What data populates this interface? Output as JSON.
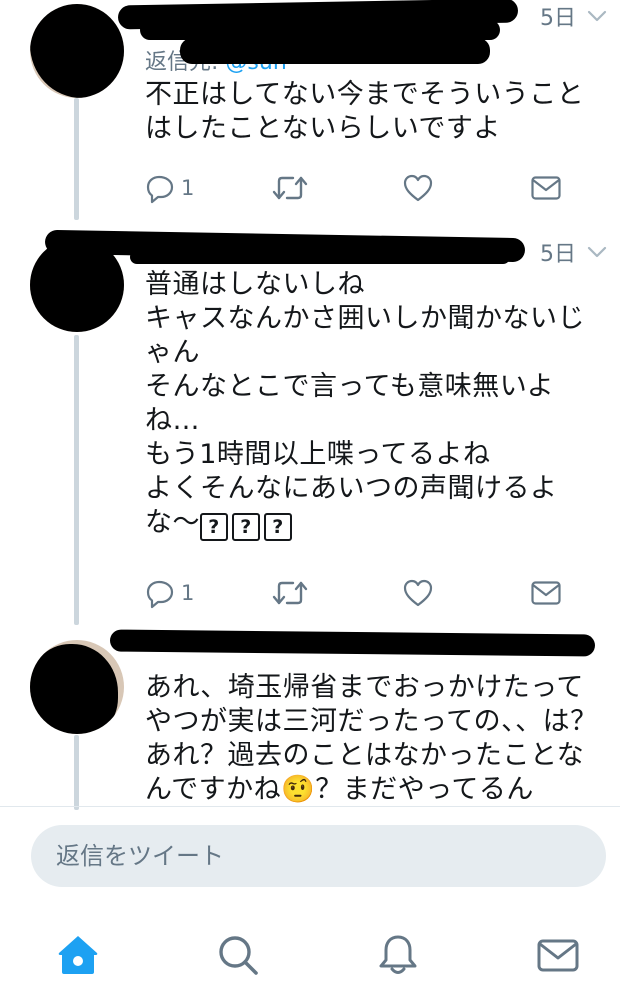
{
  "tweets": [
    {
      "timestamp": "5日",
      "reply_label": "返信先:",
      "reply_handle": "@sun",
      "text": "不正はしてない今までそういうことはしたことないらしいですよ",
      "reply_count": "1"
    },
    {
      "timestamp": "5日",
      "text_lines": [
        "普通はしないしね",
        "キャスなんかさ囲いしか聞かないじゃん",
        "そんなとこで言っても意味無いよね…",
        "もう1時間以上喋ってるよね",
        "よくそんなにあいつの声聞けるよな〜"
      ],
      "unknown_glyphs": [
        "?",
        "?",
        "?"
      ],
      "reply_count": "1"
    },
    {
      "text": "あれ、埼玉帰省までおっかけたってやつが実は三河だったっての、、は？あれ？過去のことはなかったことなんですかね🤨？まだやってるん"
    }
  ],
  "reply_box": {
    "placeholder": "返信をツイート"
  },
  "tabbar": {
    "items": [
      "home-icon",
      "search-icon",
      "notifications-icon",
      "messages-icon"
    ],
    "active": "home-icon"
  },
  "colors": {
    "accent": "#1da1f2",
    "secondary_text": "#657786",
    "thread_line": "#ccd6dd",
    "reply_box_bg": "#e6ecf0"
  }
}
